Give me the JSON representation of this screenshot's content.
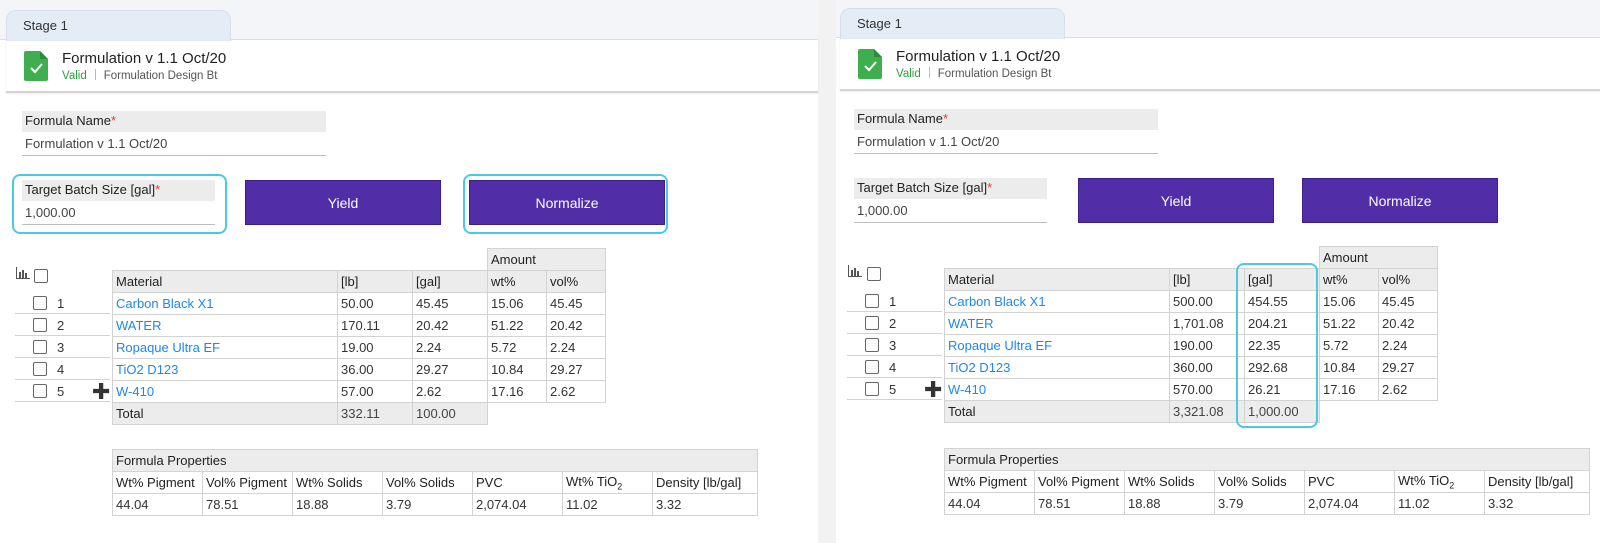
{
  "stage_tab": "Stage 1",
  "header": {
    "title": "Formulation v 1.1 Oct/20",
    "status": "Valid",
    "design": "Formulation Design Bt"
  },
  "form": {
    "name_label": "Formula Name",
    "name_value": "Formulation v 1.1 Oct/20",
    "batch_label": "Target Batch Size [gal]",
    "batch_value": "1,000.00",
    "required_mark": "*"
  },
  "buttons": {
    "yield": "Yield",
    "normalize": "Normalize"
  },
  "table_headers": {
    "amount": "Amount",
    "material": "Material",
    "lb": "[lb]",
    "gal": "[gal]",
    "wt": "wt%",
    "vol": "vol%",
    "total": "Total"
  },
  "left": {
    "rows": [
      {
        "n": "1",
        "material": "Carbon Black X1",
        "lb": "50.00",
        "gal": "45.45",
        "wt": "15.06",
        "vol": "45.45"
      },
      {
        "n": "2",
        "material": "WATER",
        "lb": "170.11",
        "gal": "20.42",
        "wt": "51.22",
        "vol": "20.42"
      },
      {
        "n": "3",
        "material": "Ropaque Ultra EF",
        "lb": "19.00",
        "gal": "2.24",
        "wt": "5.72",
        "vol": "2.24"
      },
      {
        "n": "4",
        "material": "TiO2 D123",
        "lb": "36.00",
        "gal": "29.27",
        "wt": "10.84",
        "vol": "29.27"
      },
      {
        "n": "5",
        "material": "W-410",
        "lb": "57.00",
        "gal": "2.62",
        "wt": "17.16",
        "vol": "2.62"
      }
    ],
    "total_lb": "332.11",
    "total_gal": "100.00"
  },
  "right": {
    "rows": [
      {
        "n": "1",
        "material": "Carbon Black X1",
        "lb": "500.00",
        "gal": "454.55",
        "wt": "15.06",
        "vol": "45.45"
      },
      {
        "n": "2",
        "material": "WATER",
        "lb": "1,701.08",
        "gal": "204.21",
        "wt": "51.22",
        "vol": "20.42"
      },
      {
        "n": "3",
        "material": "Ropaque Ultra EF",
        "lb": "190.00",
        "gal": "22.35",
        "wt": "5.72",
        "vol": "2.24"
      },
      {
        "n": "4",
        "material": "TiO2 D123",
        "lb": "360.00",
        "gal": "292.68",
        "wt": "10.84",
        "vol": "29.27"
      },
      {
        "n": "5",
        "material": "W-410",
        "lb": "570.00",
        "gal": "26.21",
        "wt": "17.16",
        "vol": "2.62"
      }
    ],
    "total_lb": "3,321.08",
    "total_gal": "1,000.00"
  },
  "properties": {
    "title": "Formula Properties",
    "headers": [
      "Wt% Pigment",
      "Vol% Pigment",
      "Wt% Solids",
      "Vol% Solids",
      "PVC",
      "Wt% TiO",
      "Density [lb/gal]"
    ],
    "tio2_subscript": "2",
    "values": [
      "44.04",
      "78.51",
      "18.88",
      "3.79",
      "2,074.04",
      "11.02",
      "3.32"
    ]
  },
  "colors": {
    "button": "#512da8",
    "link": "#1e88e5",
    "valid": "#2e9e3e",
    "highlight": "#4dc8e0",
    "required": "#e53935"
  },
  "icons": [
    "document-check-icon",
    "chart-bars-icon",
    "checkbox-icon",
    "plus-icon"
  ]
}
